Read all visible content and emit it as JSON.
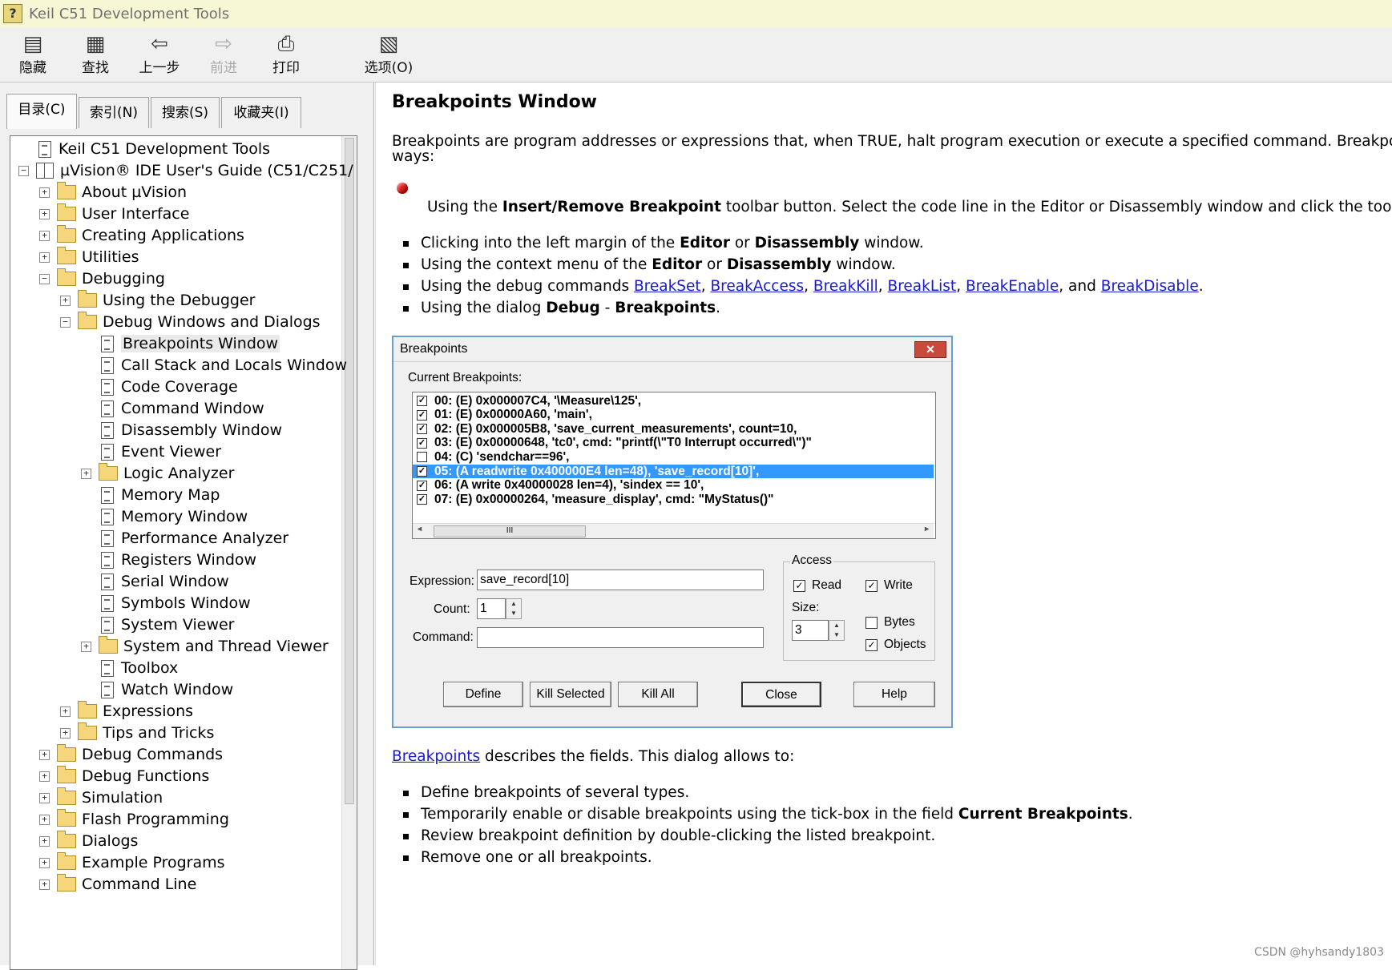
{
  "window": {
    "title": "Keil C51 Development Tools"
  },
  "toolbar": {
    "hide": "隐藏",
    "find": "查找",
    "back": "上一步",
    "forward": "前进",
    "print": "打印",
    "options": "选项(O)"
  },
  "tabs": [
    "目录(C)",
    "索引(N)",
    "搜索(S)",
    "收藏夹(I)"
  ],
  "tree": [
    {
      "label": "Keil C51 Development Tools",
      "indent": 0,
      "icon": "doc",
      "exp": ""
    },
    {
      "label": "µVision® IDE User's Guide (C51/C251/",
      "indent": 0,
      "icon": "book",
      "exp": "−"
    },
    {
      "label": "About µVision",
      "indent": 1,
      "icon": "folder",
      "exp": "+"
    },
    {
      "label": "User Interface",
      "indent": 1,
      "icon": "folder",
      "exp": "+"
    },
    {
      "label": "Creating Applications",
      "indent": 1,
      "icon": "folder",
      "exp": "+"
    },
    {
      "label": "Utilities",
      "indent": 1,
      "icon": "folder",
      "exp": "+"
    },
    {
      "label": "Debugging",
      "indent": 1,
      "icon": "folder",
      "exp": "−"
    },
    {
      "label": "Using the Debugger",
      "indent": 2,
      "icon": "folder",
      "exp": "+"
    },
    {
      "label": "Debug Windows and Dialogs",
      "indent": 2,
      "icon": "folder",
      "exp": "−"
    },
    {
      "label": "Breakpoints Window",
      "indent": 3,
      "icon": "doc",
      "exp": "",
      "selected": true
    },
    {
      "label": "Call Stack and Locals Window",
      "indent": 3,
      "icon": "doc",
      "exp": ""
    },
    {
      "label": "Code Coverage",
      "indent": 3,
      "icon": "doc",
      "exp": ""
    },
    {
      "label": "Command Window",
      "indent": 3,
      "icon": "doc",
      "exp": ""
    },
    {
      "label": "Disassembly Window",
      "indent": 3,
      "icon": "doc",
      "exp": ""
    },
    {
      "label": "Event Viewer",
      "indent": 3,
      "icon": "doc",
      "exp": ""
    },
    {
      "label": "Logic Analyzer",
      "indent": 3,
      "icon": "folder",
      "exp": "+"
    },
    {
      "label": "Memory Map",
      "indent": 3,
      "icon": "doc",
      "exp": ""
    },
    {
      "label": "Memory Window",
      "indent": 3,
      "icon": "doc",
      "exp": ""
    },
    {
      "label": "Performance Analyzer",
      "indent": 3,
      "icon": "doc",
      "exp": ""
    },
    {
      "label": "Registers Window",
      "indent": 3,
      "icon": "doc",
      "exp": ""
    },
    {
      "label": "Serial Window",
      "indent": 3,
      "icon": "doc",
      "exp": ""
    },
    {
      "label": "Symbols Window",
      "indent": 3,
      "icon": "doc",
      "exp": ""
    },
    {
      "label": "System Viewer",
      "indent": 3,
      "icon": "doc",
      "exp": ""
    },
    {
      "label": "System and Thread Viewer",
      "indent": 3,
      "icon": "folder",
      "exp": "+"
    },
    {
      "label": "Toolbox",
      "indent": 3,
      "icon": "doc",
      "exp": ""
    },
    {
      "label": "Watch Window",
      "indent": 3,
      "icon": "doc",
      "exp": ""
    },
    {
      "label": "Expressions",
      "indent": 2,
      "icon": "folder",
      "exp": "+"
    },
    {
      "label": "Tips and Tricks",
      "indent": 2,
      "icon": "folder",
      "exp": "+"
    },
    {
      "label": "Debug Commands",
      "indent": 1,
      "icon": "folder",
      "exp": "+"
    },
    {
      "label": "Debug Functions",
      "indent": 1,
      "icon": "folder",
      "exp": "+"
    },
    {
      "label": "Simulation",
      "indent": 1,
      "icon": "folder",
      "exp": "+"
    },
    {
      "label": "Flash Programming",
      "indent": 1,
      "icon": "folder",
      "exp": "+"
    },
    {
      "label": "Dialogs",
      "indent": 1,
      "icon": "folder",
      "exp": "+"
    },
    {
      "label": "Example Programs",
      "indent": 1,
      "icon": "folder",
      "exp": "+"
    },
    {
      "label": "Command Line",
      "indent": 1,
      "icon": "folder",
      "exp": "+"
    }
  ],
  "content": {
    "heading": "Breakpoints Window",
    "intro_line1": "Breakpoints are program addresses or expressions that, when TRUE, halt program execution or execute a specified command. Breakpoints can be set in several",
    "intro_line2": "ways:",
    "red_item": {
      "pre": "Using the ",
      "bold": "Insert/Remove Breakpoint",
      "post": " toolbar button. Select the code line in the Editor or Disassembly window and click the toolbar button."
    },
    "bullets1": [
      {
        "pre": "Clicking into the left margin of the ",
        "b1": "Editor",
        "mid": " or ",
        "b2": "Disassembly",
        "post": " window."
      },
      {
        "pre": "Using the context menu of the ",
        "b1": "Editor",
        "mid": " or ",
        "b2": "Disassembly",
        "post": " window."
      }
    ],
    "debug_cmds": {
      "pre": "Using the debug commands ",
      "links": [
        "BreakSet",
        "BreakAccess",
        "BreakKill",
        "BreakList",
        "BreakEnable",
        "BreakDisable"
      ],
      "sep": ", ",
      "and": ", and ",
      "end": "."
    },
    "dialog_item": {
      "pre": "Using the dialog ",
      "b1": "Debug",
      "mid": " - ",
      "b2": "Breakpoints",
      "end": "."
    },
    "after_link": "Breakpoints",
    "after_text": " describes the fields. This dialog allows to:",
    "bullets2": [
      {
        "pre": "Define breakpoints of several types.",
        "bold": "",
        "post": ""
      },
      {
        "pre": "Temporarily enable or disable breakpoints using the tick-box in the field ",
        "bold": "Current Breakpoints",
        "post": "."
      },
      {
        "pre": "Review breakpoint definition by double-clicking the listed breakpoint.",
        "bold": "",
        "post": ""
      },
      {
        "pre": "Remove one or all breakpoints.",
        "bold": "",
        "post": ""
      }
    ]
  },
  "dialog": {
    "title": "Breakpoints",
    "current_label": "Current Breakpoints:",
    "breakpoints": [
      {
        "text": "00: (E) 0x000007C4,  '\\Measure\\125',",
        "checked": true,
        "selected": false
      },
      {
        "text": "01: (E) 0x00000A60,  'main',",
        "checked": true,
        "selected": false
      },
      {
        "text": "02: (E) 0x000005B8,  'save_current_measurements',  count=10,",
        "checked": true,
        "selected": false
      },
      {
        "text": "03: (E) 0x00000648,  'tc0',  cmd: \"printf(\\\"T0 Interrupt occurred\\\")\"",
        "checked": true,
        "selected": false
      },
      {
        "text": "04: (C)  'sendchar==96',",
        "checked": false,
        "selected": false
      },
      {
        "text": "05: (A readwrite 0x400000E4 len=48),  'save_record[10]',",
        "checked": true,
        "selected": true
      },
      {
        "text": "06: (A write 0x40000028 len=4),  'sindex == 10',",
        "checked": true,
        "selected": false
      },
      {
        "text": "07: (E) 0x00000264,  'measure_display',  cmd: \"MyStatus()\"",
        "checked": true,
        "selected": false
      }
    ],
    "scroll_grip": "III",
    "expression_label": "Expression:",
    "expression_value": "save_record[10]",
    "count_label": "Count:",
    "count_value": "1",
    "command_label": "Command:",
    "command_value": "",
    "access": {
      "legend": "Access",
      "read": "Read",
      "write": "Write",
      "size_label": "Size:",
      "size_value": "3",
      "bytes": "Bytes",
      "objects": "Objects",
      "read_checked": true,
      "write_checked": true,
      "bytes_checked": false,
      "objects_checked": true
    },
    "buttons": {
      "define": "Define",
      "kill_selected": "Kill Selected",
      "kill_all": "Kill All",
      "close": "Close",
      "help": "Help"
    }
  },
  "watermark": "CSDN @hyhsandy1803"
}
